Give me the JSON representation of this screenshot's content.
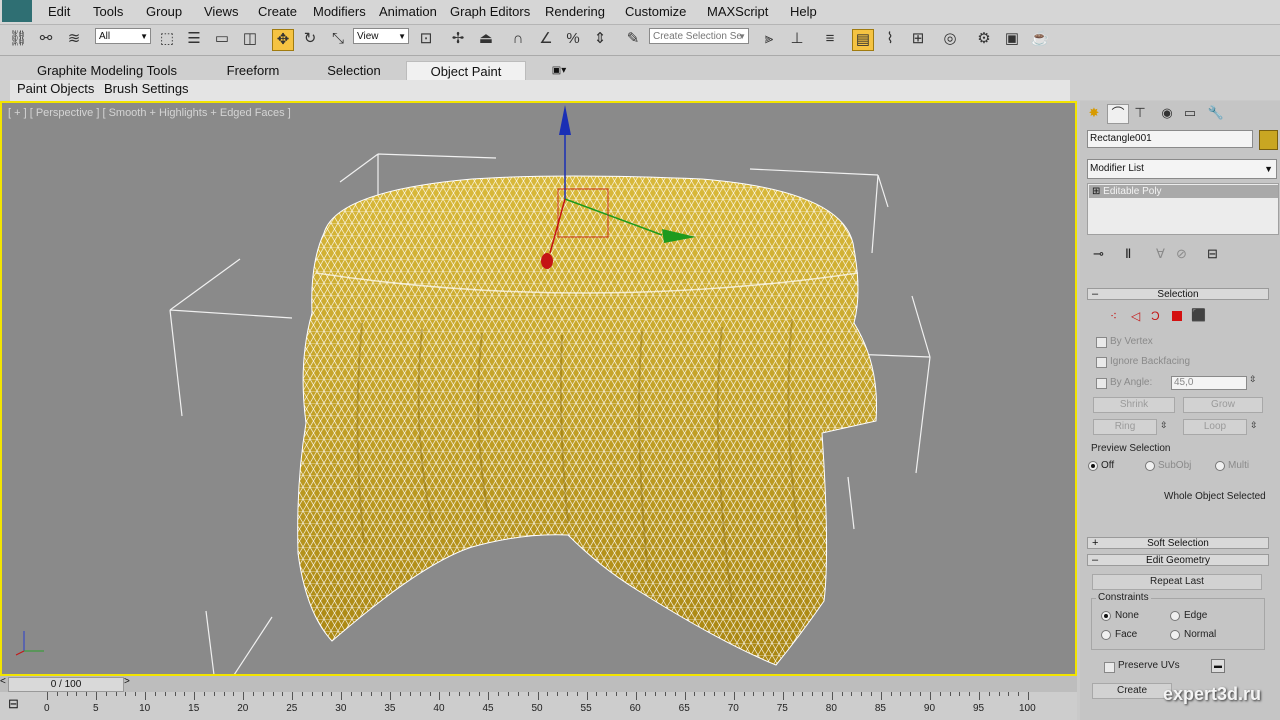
{
  "menu": [
    "Edit",
    "Tools",
    "Group",
    "Views",
    "Create",
    "Modifiers",
    "Animation",
    "Graph Editors",
    "Rendering",
    "Customize",
    "MAXScript",
    "Help"
  ],
  "toolbar": {
    "selection_filter": "All",
    "reference_coord": "View",
    "named_selection_placeholder": "Create Selection Se"
  },
  "ribbon": {
    "tabs": [
      "Graphite Modeling Tools",
      "Freeform",
      "Selection",
      "Object Paint"
    ],
    "active_tab": "Object Paint",
    "subtabs": [
      "Paint Objects",
      "Brush Settings"
    ]
  },
  "viewport": {
    "label": "[ + ] [ Perspective ] [ Smooth + Highlights + Edged Faces ]",
    "object_color": "#c9a622",
    "wire_color": "#ffffff"
  },
  "command_panel": {
    "object_name": "Rectangle001",
    "object_color": "#c9a622",
    "modifier_list_label": "Modifier List",
    "stack_item": "Editable Poly",
    "selection": {
      "title": "Selection",
      "by_vertex": "By Vertex",
      "ignore_backfacing": "Ignore Backfacing",
      "by_angle": "By Angle:",
      "angle_value": "45,0",
      "shrink": "Shrink",
      "grow": "Grow",
      "ring": "Ring",
      "loop": "Loop",
      "preview_selection": "Preview Selection",
      "off": "Off",
      "subobj": "SubObj",
      "multi": "Multi",
      "status": "Whole Object Selected"
    },
    "soft_selection": {
      "title": "Soft Selection",
      "sign": "+"
    },
    "edit_geometry": {
      "title": "Edit Geometry",
      "sign": "–",
      "repeat_last": "Repeat Last",
      "constraints": "Constraints",
      "none": "None",
      "edge": "Edge",
      "face": "Face",
      "normal": "Normal",
      "preserve_uvs": "Preserve UVs",
      "create": "Create"
    }
  },
  "timeline": {
    "frame_readout": "0 / 100",
    "prev": "<",
    "next": ">",
    "ticks": [
      "0",
      "5",
      "10",
      "15",
      "20",
      "25",
      "30",
      "35",
      "40",
      "45",
      "50",
      "55",
      "60",
      "65",
      "70",
      "75",
      "80",
      "85",
      "90",
      "95",
      "100"
    ]
  },
  "watermark": "expert3d.ru"
}
